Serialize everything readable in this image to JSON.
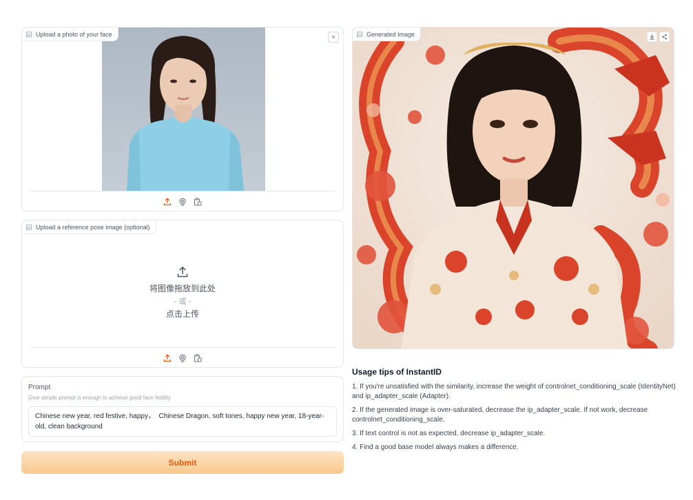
{
  "face_upload": {
    "label": "Upload a photo of your face",
    "close_symbol": "×",
    "image_subject": "woman-portrait-photo"
  },
  "pose_upload": {
    "label": "Upload a reference pose image (optional)",
    "drop_text": "将图像拖放到此处",
    "or_text": "- 或 -",
    "click_text": "点击上传"
  },
  "toolbar_icons": [
    "upload-icon",
    "webcam-icon",
    "clipboard-icon"
  ],
  "prompt": {
    "label": "Prompt",
    "info": "Give simple prompt is enough to achieve good face fedility",
    "value": "Chinese new year, red festive, happy，  Chinese Dragon, soft tones, happy new year, 18-year-old, clean background"
  },
  "submit_label": "Submit",
  "generated": {
    "label": "Generated Image",
    "image_subject": "woman-with-red-dragons-illustration"
  },
  "tips": {
    "title": "Usage tips of InstantID",
    "items": [
      "1. If you're unsatisfied with the similarity, increase the weight of controlnet_conditioning_scale (IdentityNet) and ip_adapter_scale (Adapter).",
      "2. If the generated image is over-saturated, decrease the ip_adapter_scale. If not work, decrease controlnet_conditioning_scale.",
      "3. If text control is not as expected, decrease ip_adapter_scale.",
      "4. Find a good base model always makes a difference."
    ]
  },
  "colors": {
    "accent": "#ea580c",
    "submit_gradient_top": "#fde3c4",
    "submit_gradient_bottom": "#f8c88d",
    "border": "#e5e7eb"
  }
}
